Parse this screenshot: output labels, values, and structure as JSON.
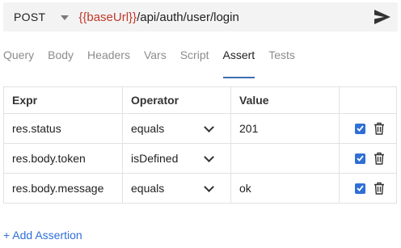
{
  "request": {
    "method": "POST",
    "url_variable": "{{baseUrl}}",
    "url_path": "/api/auth/user/login"
  },
  "tabs": [
    {
      "label": "Query",
      "active": false
    },
    {
      "label": "Body",
      "active": false
    },
    {
      "label": "Headers",
      "active": false
    },
    {
      "label": "Vars",
      "active": false
    },
    {
      "label": "Script",
      "active": false
    },
    {
      "label": "Assert",
      "active": true
    },
    {
      "label": "Tests",
      "active": false
    }
  ],
  "assert_table": {
    "headers": {
      "expr": "Expr",
      "operator": "Operator",
      "value": "Value"
    },
    "rows": [
      {
        "expr": "res.status",
        "operator": "equals",
        "value": "201",
        "enabled": true
      },
      {
        "expr": "res.body.token",
        "operator": "isDefined",
        "value": "",
        "enabled": true
      },
      {
        "expr": "res.body.message",
        "operator": "equals",
        "value": "ok",
        "enabled": true
      }
    ]
  },
  "add_assertion_label": "+ Add Assertion",
  "colors": {
    "variable": "#c0392b",
    "accent": "#2f6fd6",
    "tab_underline": "#3c6fb5"
  },
  "icons": {
    "send": "send-icon",
    "dropdown": "chevron-down-icon",
    "delete": "trash-icon",
    "checkbox": "checkbox-checked-icon"
  }
}
